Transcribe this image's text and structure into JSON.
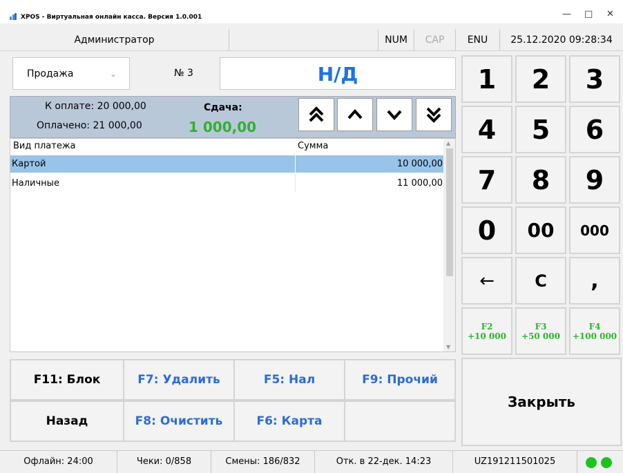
{
  "window": {
    "title": "XPOS - Виртуальная онлайн касса. Версия 1.0.001"
  },
  "status_top": {
    "user": "Администратор",
    "num": "NUM",
    "cap": "CAP",
    "lang": "ENU",
    "datetime": "25.12.2020 09:28:34"
  },
  "receipt": {
    "mode": "Продажа",
    "number": "№ 3",
    "display": "Н/Д"
  },
  "payment": {
    "to_pay": "К оплате: 20 000,00",
    "paid": "Оплачено: 21 000,00",
    "change_label": "Сдача:",
    "change_value": "1 000,00"
  },
  "grid": {
    "columns": [
      "Вид платежа",
      "Сумма"
    ],
    "rows": [
      {
        "type": "Картой",
        "sum": "10 000,00",
        "selected": true
      },
      {
        "type": "Наличные",
        "sum": "11 000,00",
        "selected": false
      }
    ]
  },
  "actions": {
    "block": "F11: Блок",
    "delete": "F7: Удалить",
    "cash": "F5: Нал",
    "other": "F9: Прочий",
    "back": "Назад",
    "clear": "F8: Очистить",
    "card": "F6: Карта"
  },
  "keypad": {
    "keys": [
      "1",
      "2",
      "3",
      "4",
      "5",
      "6",
      "7",
      "8",
      "9",
      "0",
      "00",
      "000",
      "←",
      "C",
      ","
    ],
    "quick": [
      {
        "key": "F2",
        "amount": "+10 000"
      },
      {
        "key": "F3",
        "amount": "+50 000"
      },
      {
        "key": "F4",
        "amount": "+100 000"
      }
    ],
    "close": "Закрыть"
  },
  "status_bottom": {
    "offline": "Офлайн: 24:00",
    "checks": "Чеки: 0/858",
    "shifts": "Смены: 186/832",
    "opened": "Отк. в 22-дек. 14:23",
    "serial": "UZ191211501025"
  },
  "colors": {
    "accent_blue": "#1a73e8",
    "accent_green": "#2db32d",
    "selection": "#99c4e9",
    "panel": "#b9c8d8"
  }
}
